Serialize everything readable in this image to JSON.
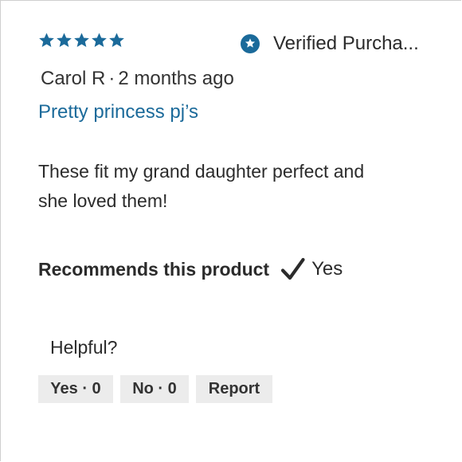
{
  "review": {
    "rating": 5,
    "max_rating": 5,
    "star_color": "#1b6a9a",
    "verified_label": "Verified Purcha...",
    "reviewer": "Carol R",
    "separator": "·",
    "time_ago": "2 months ago",
    "title": "Pretty princess pj’s",
    "body": "These fit my grand daughter perfect and she loved them!",
    "recommends_label": "Recommends this product",
    "recommends_value": "Yes"
  },
  "feedback": {
    "prompt": "Helpful?",
    "yes_label": "Yes · 0",
    "no_label": "No · 0",
    "report_label": "Report"
  },
  "colors": {
    "accent": "#1b6a9a",
    "button_bg": "#ececec",
    "text": "#2b2b2b"
  }
}
